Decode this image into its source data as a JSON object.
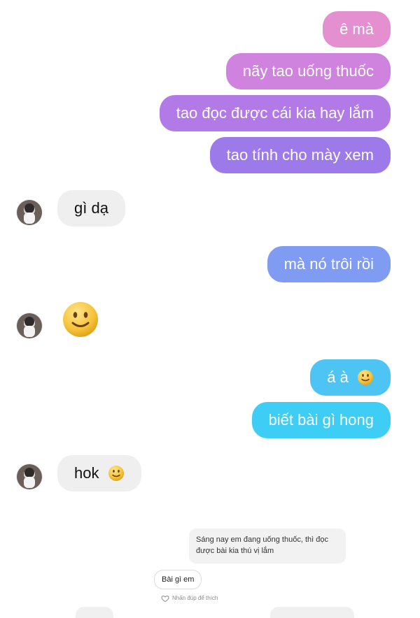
{
  "messages": {
    "out": [
      "ê mà",
      "nãy tao uống thuốc",
      "tao đọc được cái kia hay lắm",
      "tao tính cho mày xem",
      "mà nó trôi rồi",
      "á à",
      "biết bài gì hong"
    ],
    "in": [
      "gì dạ",
      "hok"
    ]
  },
  "embedded_preview": {
    "caption": "Sáng nay em đang uống thuốc, thì đọc được bài kia thú vị lắm",
    "reply": "Bài gì em",
    "hint": "Nhấn đúp để thích"
  },
  "icons": {
    "smile": "slightly-smiling-face-emoji",
    "heart": "heart-outline-icon"
  },
  "colors": {
    "bubble_pink": "#e48fcf",
    "bubble_purple": "#b27ae6",
    "bubble_blue": "#7f9cf2",
    "bubble_cyan": "#3dcdf5",
    "bubble_gray": "#efefef"
  }
}
